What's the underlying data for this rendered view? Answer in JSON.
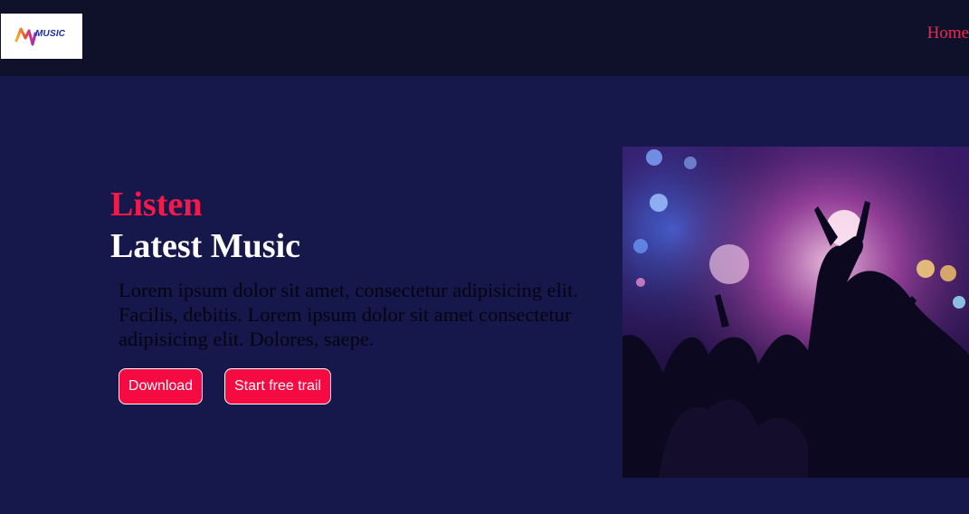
{
  "nav": {
    "logo_text": "MUSIC",
    "home_link": "Home"
  },
  "hero": {
    "headline_accent": "Listen",
    "headline_main": "Latest Music",
    "description": "Lorem ipsum dolor sit amet, consectetur adipisicing elit. Facilis, debitis. Lorem ipsum dolor sit amet consectetur adipisicing elit. Dolores, saepe.",
    "buttons": {
      "download": "Download",
      "trial": "Start free trail"
    }
  },
  "colors": {
    "navbar_bg": "#0f112b",
    "page_bg": "#16174a",
    "accent": "#f21a4b",
    "button_bg": "#f50a42",
    "heading_white": "#ffffff"
  },
  "icons": {
    "logo": "mymusic-logo",
    "hero_image": "concert-crowd-photo"
  }
}
